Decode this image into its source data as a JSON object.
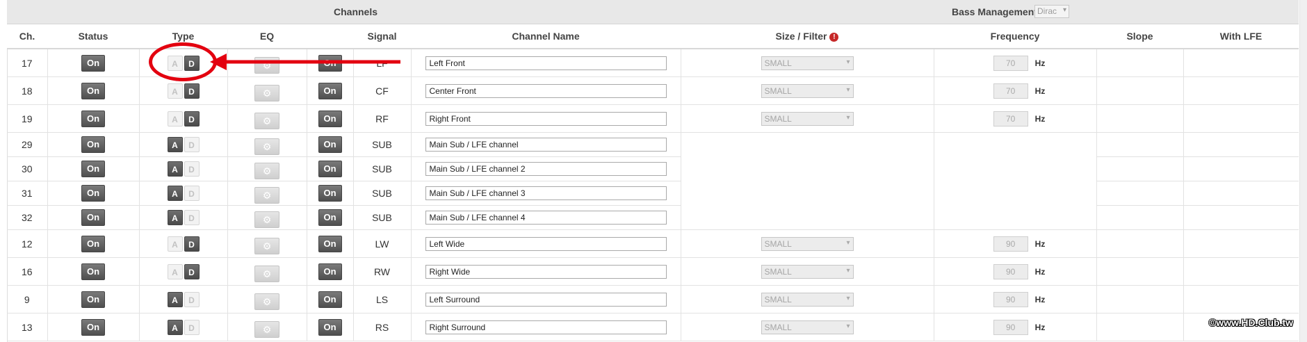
{
  "group_header": {
    "channels_label": "Channels",
    "bass_label": "Bass Management",
    "bass_select_value": "Dirac"
  },
  "columns": {
    "ch": "Ch.",
    "status": "Status",
    "type": "Type",
    "eq": "EQ",
    "signal": "Signal",
    "channel_name": "Channel Name",
    "size_filter": "Size / Filter",
    "frequency": "Frequency",
    "slope": "Slope",
    "with_lfe": "With LFE"
  },
  "labels": {
    "on": "On",
    "a": "A",
    "d": "D",
    "hz": "Hz",
    "size_info": "!"
  },
  "rows": [
    {
      "ch": "17",
      "status": "On",
      "type_active": "D",
      "output": "On",
      "signal": "LF",
      "name": "Left Front",
      "size": "SMALL",
      "freq": "70"
    },
    {
      "ch": "18",
      "status": "On",
      "type_active": "D",
      "output": "On",
      "signal": "CF",
      "name": "Center Front",
      "size": "SMALL",
      "freq": "70"
    },
    {
      "ch": "19",
      "status": "On",
      "type_active": "D",
      "output": "On",
      "signal": "RF",
      "name": "Right Front",
      "size": "SMALL",
      "freq": "70"
    },
    {
      "ch": "29",
      "status": "On",
      "type_active": "A",
      "output": "On",
      "signal": "SUB",
      "name": "Main Sub / LFE channel"
    },
    {
      "ch": "30",
      "status": "On",
      "type_active": "A",
      "output": "On",
      "signal": "SUB",
      "name": "Main Sub / LFE channel 2"
    },
    {
      "ch": "31",
      "status": "On",
      "type_active": "A",
      "output": "On",
      "signal": "SUB",
      "name": "Main Sub / LFE channel 3"
    },
    {
      "ch": "32",
      "status": "On",
      "type_active": "A",
      "output": "On",
      "signal": "SUB",
      "name": "Main Sub / LFE channel 4"
    },
    {
      "ch": "12",
      "status": "On",
      "type_active": "D",
      "output": "On",
      "signal": "LW",
      "name": "Left Wide",
      "size": "SMALL",
      "freq": "90"
    },
    {
      "ch": "16",
      "status": "On",
      "type_active": "D",
      "output": "On",
      "signal": "RW",
      "name": "Right Wide",
      "size": "SMALL",
      "freq": "90"
    },
    {
      "ch": "9",
      "status": "On",
      "type_active": "A",
      "output": "On",
      "signal": "LS",
      "name": "Left Surround",
      "size": "SMALL",
      "freq": "90"
    },
    {
      "ch": "13",
      "status": "On",
      "type_active": "A",
      "output": "On",
      "signal": "RS",
      "name": "Right Surround",
      "size": "SMALL",
      "freq": "90"
    }
  ],
  "watermark": "©www.HD.Club.tw",
  "colors": {
    "annotation": "#e3000f",
    "info_icon": "#c62828"
  }
}
